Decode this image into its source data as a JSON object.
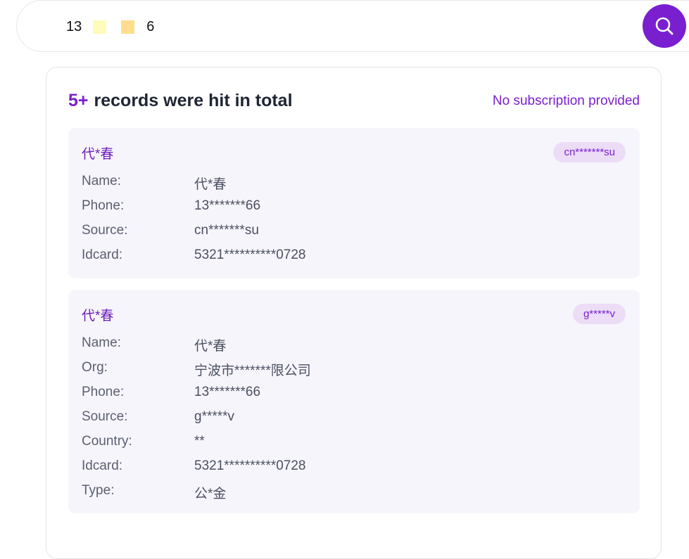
{
  "search": {
    "query_prefix": "13",
    "query_suffix": "6",
    "button_icon": "search-icon"
  },
  "results": {
    "count": "5+",
    "summary_text": "records were hit in total",
    "subscription_text": "No subscription provided"
  },
  "records": [
    {
      "title": "代*春",
      "badge": "cn*******su",
      "fields": [
        {
          "label": "Name:",
          "value": "代*春"
        },
        {
          "label": "Phone:",
          "value": "13*******66"
        },
        {
          "label": "Source:",
          "value": "cn*******su"
        },
        {
          "label": "Idcard:",
          "value": "5321**********0728"
        }
      ]
    },
    {
      "title": "代*春",
      "badge": "g*****v",
      "fields": [
        {
          "label": "Name:",
          "value": "代*春"
        },
        {
          "label": "Org:",
          "value": "宁波市*******限公司"
        },
        {
          "label": "Phone:",
          "value": "13*******66"
        },
        {
          "label": "Source:",
          "value": "g*****v"
        },
        {
          "label": "Country:",
          "value": "**"
        },
        {
          "label": "Idcard:",
          "value": "5321**********0728"
        },
        {
          "label": "Type:",
          "value": "公*金"
        }
      ]
    }
  ],
  "colors": {
    "accent": "#7a1fd0",
    "record_bg": "#f7f5fc",
    "badge_bg": "#ecdcf6"
  }
}
